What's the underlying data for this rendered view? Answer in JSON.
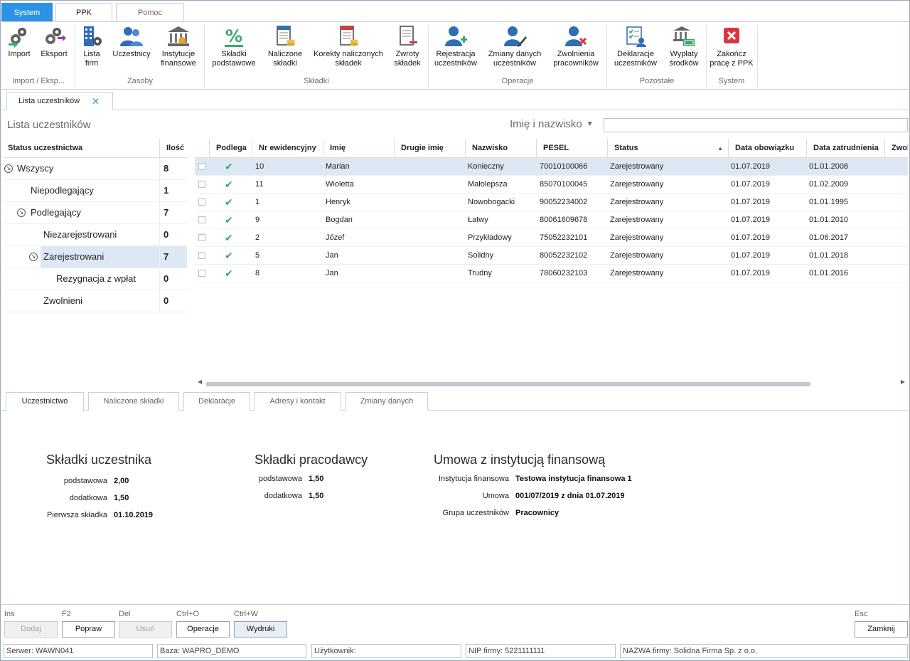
{
  "top_tabs": [
    {
      "label": "System"
    },
    {
      "label": "PPK"
    },
    {
      "label": "Pomoc"
    }
  ],
  "ribbon": {
    "buttons": [
      {
        "label1": "Import",
        "label2": ""
      },
      {
        "label1": "Eksport",
        "label2": ""
      },
      {
        "label1": "Lista",
        "label2": "firm"
      },
      {
        "label1": "Uczestnicy",
        "label2": ""
      },
      {
        "label1": "Instytucje",
        "label2": "finansowe"
      },
      {
        "label1": "Składki",
        "label2": "podstawowe"
      },
      {
        "label1": "Naliczone",
        "label2": "składki"
      },
      {
        "label1": "Korekty naliczonych",
        "label2": "składek"
      },
      {
        "label1": "Zwroty",
        "label2": "składek"
      },
      {
        "label1": "Rejestracja",
        "label2": "uczestników"
      },
      {
        "label1": "Zmiany danych",
        "label2": "uczestników"
      },
      {
        "label1": "Zwolnienia",
        "label2": "pracowników"
      },
      {
        "label1": "Deklaracje",
        "label2": "uczestników"
      },
      {
        "label1": "Wypłaty",
        "label2": "środków"
      },
      {
        "label1": "Zakończ",
        "label2": "pracę z PPK"
      }
    ],
    "groups": [
      "Import / Eksp...",
      "Zasoby",
      "Składki",
      "Operacje",
      "Pozostałe",
      "System"
    ]
  },
  "doc_tab": {
    "label": "Lista uczestników",
    "close": "✕"
  },
  "list_title": "Lista uczestników",
  "filter": {
    "label": "Imię i nazwisko",
    "value": ""
  },
  "tree": {
    "headers": {
      "status": "Status uczestnictwa",
      "count": "Ilość"
    },
    "rows": [
      {
        "label": "Wszyscy",
        "count": "8"
      },
      {
        "label": "Niepodlegający",
        "count": "1"
      },
      {
        "label": "Podlegający",
        "count": "7"
      },
      {
        "label": "Niezarejestrowani",
        "count": "0"
      },
      {
        "label": "Zarejestrowani",
        "count": "7"
      },
      {
        "label": "Rezygnacja z wpłat",
        "count": "0"
      },
      {
        "label": "Zwolnieni",
        "count": "0"
      }
    ]
  },
  "grid": {
    "headers": [
      "Podlega",
      "Nr ewidencyjny",
      "Imię",
      "Drugie imię",
      "Nazwisko",
      "PESEL",
      "Status",
      "Data obowiązku",
      "Data zatrudnienia",
      "Zwol"
    ],
    "rows": [
      {
        "nr": "10",
        "imie": "Marian",
        "drugie": "",
        "nazwisko": "Konieczny",
        "pesel": "70010100066",
        "status": "Zarejestrowany",
        "obowiazek": "01.07.2019",
        "zatrudnienie": "01.01.2008"
      },
      {
        "nr": "11",
        "imie": "Wioletta",
        "drugie": "",
        "nazwisko": "Małolepsza",
        "pesel": "85070100045",
        "status": "Zarejestrowany",
        "obowiazek": "01.07.2019",
        "zatrudnienie": "01.02.2009"
      },
      {
        "nr": "1",
        "imie": "Henryk",
        "drugie": "",
        "nazwisko": "Nowobogacki",
        "pesel": "90052234002",
        "status": "Zarejestrowany",
        "obowiazek": "01.07.2019",
        "zatrudnienie": "01.01.1995"
      },
      {
        "nr": "9",
        "imie": "Bogdan",
        "drugie": "",
        "nazwisko": "Łatwy",
        "pesel": "80061609678",
        "status": "Zarejestrowany",
        "obowiazek": "01.07.2019",
        "zatrudnienie": "01.01.2010"
      },
      {
        "nr": "2",
        "imie": "Józef",
        "drugie": "",
        "nazwisko": "Przykładowy",
        "pesel": "75052232101",
        "status": "Zarejestrowany",
        "obowiazek": "01.07.2019",
        "zatrudnienie": "01.06.2017"
      },
      {
        "nr": "5",
        "imie": "Jan",
        "drugie": "",
        "nazwisko": "Solidny",
        "pesel": "80052232102",
        "status": "Zarejestrowany",
        "obowiazek": "01.07.2019",
        "zatrudnienie": "01.01.2018"
      },
      {
        "nr": "8",
        "imie": "Jan",
        "drugie": "",
        "nazwisko": "Trudny",
        "pesel": "78060232103",
        "status": "Zarejestrowany",
        "obowiazek": "01.07.2019",
        "zatrudnienie": "01.01.2016"
      }
    ]
  },
  "bottom_tabs": [
    "Uczestnictwo",
    "Naliczone składki",
    "Deklaracje",
    "Adresy i kontakt",
    "Zmiany danych"
  ],
  "details": {
    "uczestnik": {
      "title": "Składki uczestnika",
      "podstawowa_label": "podstawowa",
      "podstawowa": "2,00",
      "dodatkowa_label": "dodatkowa",
      "dodatkowa": "1,50",
      "pierwsza_label": "Pierwsza składka",
      "pierwsza": "01.10.2019"
    },
    "pracodawca": {
      "title": "Składki pracodawcy",
      "podstawowa_label": "podstawowa",
      "podstawowa": "1,50",
      "dodatkowa_label": "dodatkowa",
      "dodatkowa": "1,50"
    },
    "umowa": {
      "title": "Umowa z instytucją finansową",
      "instytucja_label": "Instytucja finansowa",
      "instytucja": "Testowa instytucja finansowa 1",
      "umowa_label": "Umowa",
      "umowa": "001/07/2019 z dnia 01.07.2019",
      "grupa_label": "Grupa uczestników",
      "grupa": "Pracownicy"
    }
  },
  "footer": {
    "hotkeys": [
      "Ins",
      "F2",
      "Del",
      "Ctrl+O",
      "Ctrl+W",
      "Esc"
    ],
    "buttons": {
      "dodaj": "Dodaj",
      "popraw": "Popraw",
      "usun": "Usuń",
      "operacje": "Operacje",
      "wydruki": "Wydruki",
      "zamknij": "Zamknij"
    },
    "status": [
      "Serwer: WAWN041",
      "Baza: WAPRO_DEMO",
      "Użytkownik:",
      "NIP firmy: 5221111111",
      "NAZWA firmy: Solidna Firma Sp. z o.o."
    ]
  },
  "colors": {
    "accent": "#2b93e6",
    "selection": "#dde8f4",
    "check": "#3aa86b",
    "danger": "#d9363e"
  }
}
